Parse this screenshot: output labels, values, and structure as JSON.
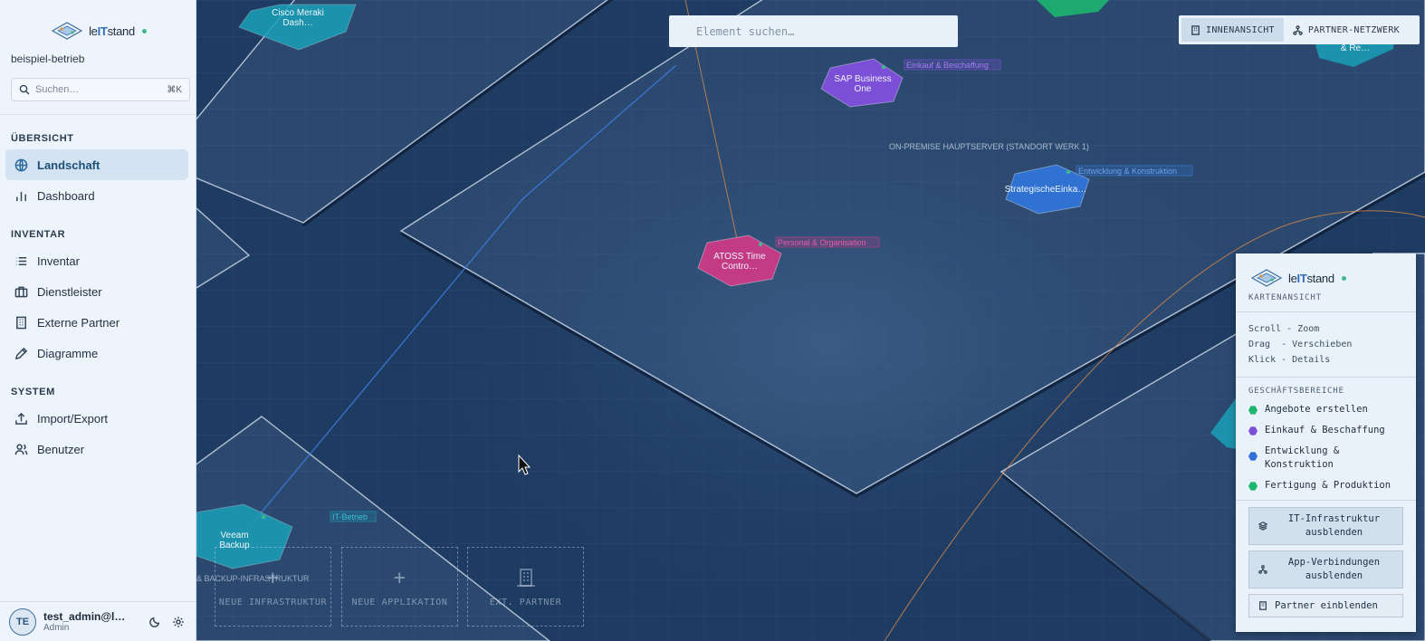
{
  "sidebar": {
    "brand": {
      "pre": "le",
      "mid": "IT",
      "post": "stand"
    },
    "tenant": "beispiel-betrieb",
    "search": {
      "placeholder": "Suchen…",
      "shortcut": "⌘K"
    },
    "sections": [
      {
        "title": "ÜBERSICHT",
        "items": [
          {
            "label": "Landschaft",
            "icon": "globe-icon",
            "active": true
          },
          {
            "label": "Dashboard",
            "icon": "bar-chart-icon"
          }
        ]
      },
      {
        "title": "INVENTAR",
        "items": [
          {
            "label": "Inventar",
            "icon": "list-icon"
          },
          {
            "label": "Dienstleister",
            "icon": "briefcase-icon"
          },
          {
            "label": "Externe Partner",
            "icon": "building-icon"
          },
          {
            "label": "Diagramme",
            "icon": "pencil-icon"
          }
        ]
      },
      {
        "title": "SYSTEM",
        "items": [
          {
            "label": "Import/Export",
            "icon": "upload-icon"
          },
          {
            "label": "Benutzer",
            "icon": "users-icon"
          }
        ]
      }
    ],
    "user": {
      "initials": "TE",
      "name": "test_admin@le…",
      "role": "Admin"
    }
  },
  "canvas": {
    "search_placeholder": "Element suchen…",
    "view_toggle": [
      {
        "label": "INNENANSICHT",
        "icon": "building-icon",
        "active": true
      },
      {
        "label": "PARTNER-NETZWERK",
        "icon": "network-icon"
      }
    ],
    "zone_title": "ON-PREMISE HAUPTSERVER (STANDORT WERK 1)",
    "zone_title_2": "& BACKUP-INFRASTRUKTUR",
    "nodes": [
      {
        "label1": "Cisco Meraki",
        "label2": "Dash…",
        "color": "#1aa0b8"
      },
      {
        "label1": "SAP Business",
        "label2": "One",
        "color": "#7b4fd6",
        "tag": "Einkauf & Beschaffung"
      },
      {
        "label1": "StrategischeEinka…",
        "label2": "",
        "color": "#2f72d1",
        "tag": "Entwicklung & Konstruktion"
      },
      {
        "label1": "ATOSS Time",
        "label2": "Contro…",
        "color": "#c43b85",
        "tag": "Personal & Organisation"
      },
      {
        "label1": "Veeam",
        "label2": "Backup",
        "color": "#1aa0b8",
        "tag": "IT-Betrieb"
      },
      {
        "label1": "",
        "label2": "& Re…",
        "color": "#1aa0b8"
      }
    ],
    "actions": [
      {
        "label": "NEUE INFRASTRUKTUR",
        "icon": "plus-icon"
      },
      {
        "label": "NEUE APPLIKATION",
        "icon": "plus-icon"
      },
      {
        "label": "EXT. PARTNER",
        "icon": "building-icon"
      }
    ]
  },
  "panel": {
    "subtitle": "KARTENANSICHT",
    "help": [
      "Scroll - Zoom",
      "Drag  - Verschieben",
      "Klick - Details"
    ],
    "legend_title": "GESCHÄFTSBEREICHE",
    "legend": [
      {
        "label": "Angebote erstellen",
        "color": "#1db56f"
      },
      {
        "label": "Einkauf & Beschaffung",
        "color": "#7b4fd6"
      },
      {
        "label": "Entwicklung & Konstruktion",
        "color": "#2f72d1"
      },
      {
        "label": "Fertigung & Produktion",
        "color": "#1db56f"
      }
    ],
    "buttons": [
      {
        "label": "IT-Infrastruktur ausblenden",
        "icon": "layers-icon"
      },
      {
        "label": "App-Verbindungen ausblenden",
        "icon": "network-icon"
      },
      {
        "label": "Partner einblenden",
        "icon": "building-icon"
      }
    ]
  }
}
